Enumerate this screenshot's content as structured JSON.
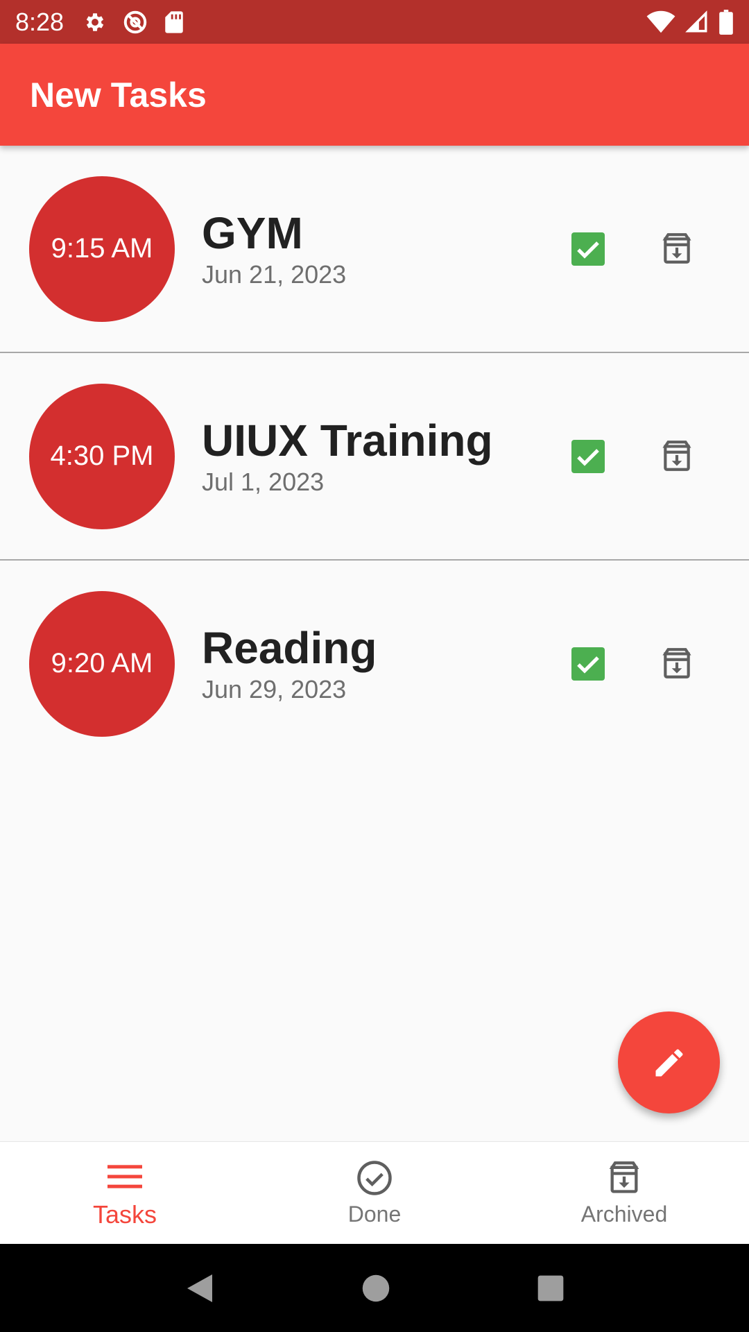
{
  "status_bar": {
    "time": "8:28",
    "icons_left": [
      "gear-icon",
      "at-sign-icon",
      "sd-card-icon"
    ],
    "icons_right": [
      "wifi-icon",
      "signal-icon",
      "battery-icon"
    ]
  },
  "app_bar": {
    "title": "New Tasks"
  },
  "tasks": [
    {
      "time": "9:15 AM",
      "title": "GYM",
      "date": "Jun 21, 2023",
      "done_icon": "checkbox-checked-icon",
      "archive_icon": "archive-icon"
    },
    {
      "time": "4:30 PM",
      "title": "UIUX Training",
      "date": "Jul 1, 2023",
      "done_icon": "checkbox-checked-icon",
      "archive_icon": "archive-icon"
    },
    {
      "time": "9:20 AM",
      "title": "Reading",
      "date": "Jun 29, 2023",
      "done_icon": "checkbox-checked-icon",
      "archive_icon": "archive-icon"
    }
  ],
  "fab": {
    "icon": "pencil-icon"
  },
  "bottom_nav": {
    "items": [
      {
        "label": "Tasks",
        "icon": "menu-icon",
        "active": true
      },
      {
        "label": "Done",
        "icon": "check-circle-icon",
        "active": false
      },
      {
        "label": "Archived",
        "icon": "archive-icon",
        "active": false
      }
    ]
  },
  "system_nav": {
    "buttons": [
      "back-icon",
      "home-icon",
      "recents-icon"
    ]
  },
  "colors": {
    "status_bar": "#b3302b",
    "primary": "#f4463c",
    "time_circle": "#d32f2f",
    "checkbox": "#4caf50",
    "icon_gray": "#5f5f5f",
    "inactive_label": "#757575"
  }
}
